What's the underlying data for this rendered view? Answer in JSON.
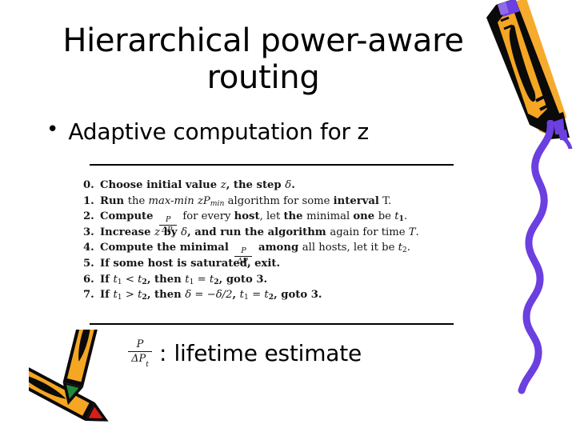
{
  "slide": {
    "title": "Hierarchical power-aware routing",
    "bullet_marker": "•",
    "bullet_text": "Adaptive computation for z"
  },
  "algorithm": {
    "lines": [
      {
        "number": "0.",
        "parts": [
          {
            "text": "Choose initial value ",
            "style": "bold"
          },
          {
            "text": "z",
            "style": "mathit"
          },
          {
            "text": ", the step ",
            "style": "bold"
          },
          {
            "text": "δ",
            "style": "mathit"
          },
          {
            "text": ".",
            "style": "bold"
          }
        ]
      },
      {
        "number": "1.",
        "parts": [
          {
            "text": "Run ",
            "style": "bold"
          },
          {
            "text": "the ",
            "style": "normal"
          },
          {
            "text": "max-min zP",
            "style": "mathit"
          },
          {
            "text": "min",
            "style": "mathit-sub"
          },
          {
            "text": " algorithm ",
            "style": "normal"
          },
          {
            "text": "for some ",
            "style": "normal"
          },
          {
            "text": "interval",
            "style": "bold"
          },
          {
            "text": " T.",
            "style": "normal"
          }
        ]
      },
      {
        "number": "2.",
        "parts": [
          {
            "text": "Compute ",
            "style": "bold"
          },
          {
            "text": "",
            "style": "fraction"
          },
          {
            "text": " for every ",
            "style": "normal"
          },
          {
            "text": "host",
            "style": "bold"
          },
          {
            "text": ", let ",
            "style": "normal"
          },
          {
            "text": "the ",
            "style": "bold"
          },
          {
            "text": "minimal ",
            "style": "normal"
          },
          {
            "text": "one ",
            "style": "bold"
          },
          {
            "text": "be ",
            "style": "normal"
          },
          {
            "text": "t",
            "style": "mathit"
          },
          {
            "text": "1",
            "style": "sub-bold"
          },
          {
            "text": ".",
            "style": "normal"
          }
        ]
      },
      {
        "number": "3.",
        "parts": [
          {
            "text": "Increase ",
            "style": "bold"
          },
          {
            "text": "z",
            "style": "mathit"
          },
          {
            "text": " by ",
            "style": "bold"
          },
          {
            "text": "δ",
            "style": "mathit"
          },
          {
            "text": ", and run the ",
            "style": "bold"
          },
          {
            "text": "algorithm ",
            "style": "bold"
          },
          {
            "text": "again for time ",
            "style": "normal"
          },
          {
            "text": "T",
            "style": "mathit"
          },
          {
            "text": ".",
            "style": "normal"
          }
        ]
      },
      {
        "number": "4.",
        "parts": [
          {
            "text": "Compute the ",
            "style": "bold"
          },
          {
            "text": "minimal ",
            "style": "bold"
          },
          {
            "text": "",
            "style": "fraction"
          },
          {
            "text": " among ",
            "style": "bold"
          },
          {
            "text": "all hosts",
            "style": "normal"
          },
          {
            "text": ", let it be ",
            "style": "normal"
          },
          {
            "text": "t",
            "style": "mathit"
          },
          {
            "text": "2",
            "style": "sub"
          },
          {
            "text": ".",
            "style": "normal"
          }
        ]
      },
      {
        "number": "5.",
        "parts": [
          {
            "text": "If some host is saturated, exit.",
            "style": "bold"
          }
        ]
      },
      {
        "number": "6.",
        "parts": [
          {
            "text": "If ",
            "style": "bold"
          },
          {
            "text": "t",
            "style": "mathit"
          },
          {
            "text": "1",
            "style": "sub"
          },
          {
            "text": " < ",
            "style": "mathit"
          },
          {
            "text": "t",
            "style": "mathit"
          },
          {
            "text": "2",
            "style": "subb"
          },
          {
            "text": ", then ",
            "style": "bold"
          },
          {
            "text": "t",
            "style": "mathit"
          },
          {
            "text": "1",
            "style": "sub"
          },
          {
            "text": " = ",
            "style": "mathit"
          },
          {
            "text": "t",
            "style": "mathit"
          },
          {
            "text": "2",
            "style": "subb"
          },
          {
            "text": ", goto 3.",
            "style": "bold"
          }
        ]
      },
      {
        "number": "7.",
        "parts": [
          {
            "text": "If ",
            "style": "bold"
          },
          {
            "text": "t",
            "style": "mathit"
          },
          {
            "text": "1",
            "style": "sub"
          },
          {
            "text": " > ",
            "style": "mathit"
          },
          {
            "text": "t",
            "style": "mathit"
          },
          {
            "text": "2",
            "style": "subb"
          },
          {
            "text": ", then ",
            "style": "bold"
          },
          {
            "text": "δ",
            "style": "mathit"
          },
          {
            "text": " = ",
            "style": "mathit"
          },
          {
            "text": "−δ/2",
            "style": "mathit"
          },
          {
            "text": ", ",
            "style": "bold"
          },
          {
            "text": "t",
            "style": "mathit"
          },
          {
            "text": "1",
            "style": "sub"
          },
          {
            "text": " = ",
            "style": "mathit"
          },
          {
            "text": "t",
            "style": "mathit"
          },
          {
            "text": "2",
            "style": "subb"
          },
          {
            "text": ", goto 3.",
            "style": "bold"
          }
        ]
      }
    ]
  },
  "fraction": {
    "numerator": "P",
    "denominator": "ΔP",
    "denominator_sub": "t"
  },
  "legend": {
    "colon": ":",
    "text": "lifetime estimate"
  },
  "colors": {
    "pencil_body": "#F5A623",
    "pencil_outline": "#000000",
    "squiggle_purple": "#6B3FE0",
    "pencil_tip_green": "#1E8A3C",
    "pencil_tip_red": "#D81E17",
    "rule": "#000000",
    "text": "#000000",
    "background": "#FFFFFF"
  },
  "clipart": {
    "pencil_top_right": "pencil-icon",
    "squiggle": "wavy-line-icon",
    "pencils_bottom_left": "crossed-pencils-icon"
  }
}
